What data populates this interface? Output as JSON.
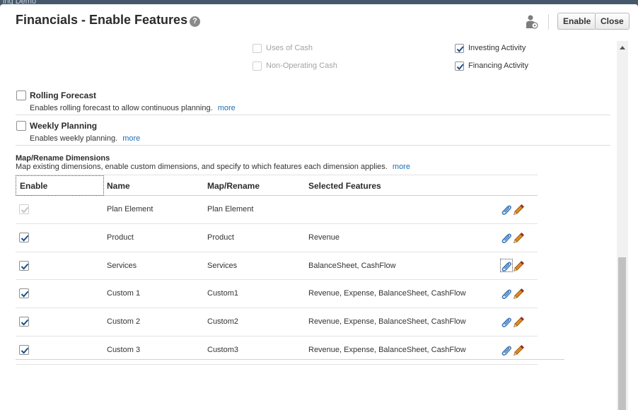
{
  "background": {
    "text": "ing Demo"
  },
  "dialog": {
    "title": "Financials - Enable Features",
    "help_icon": "?",
    "buttons": {
      "enable": "Enable",
      "close": "Close"
    }
  },
  "cash_options": [
    {
      "label": "Uses of Cash",
      "checked": false,
      "disabled": true
    },
    {
      "label": "Non-Operating Cash",
      "checked": false,
      "disabled": true
    },
    {
      "label": "Investing Activity",
      "checked": true,
      "disabled": false
    },
    {
      "label": "Financing Activity",
      "checked": true,
      "disabled": false
    }
  ],
  "features": {
    "rolling_forecast": {
      "name": "Rolling Forecast",
      "description": "Enables rolling forecast to allow continuous planning.",
      "more": "more",
      "checked": false
    },
    "weekly_planning": {
      "name": "Weekly Planning",
      "description": "Enables weekly planning.",
      "more": "more",
      "checked": false
    }
  },
  "map_rename": {
    "title": "Map/Rename Dimensions",
    "description": "Map existing dimensions, enable custom dimensions, and specify to which features each dimension applies.",
    "more": "more",
    "columns": [
      "Enable",
      "Name",
      "Map/Rename",
      "Selected Features"
    ],
    "rows": [
      {
        "enabled": true,
        "locked": true,
        "name": "Plan Element",
        "map": "Plan Element",
        "features": ""
      },
      {
        "enabled": true,
        "locked": false,
        "name": "Product",
        "map": "Product",
        "features": "Revenue"
      },
      {
        "enabled": true,
        "locked": false,
        "name": "Services",
        "map": "Services",
        "features": "BalanceSheet, CashFlow"
      },
      {
        "enabled": true,
        "locked": false,
        "name": "Custom 1",
        "map": "Custom1",
        "features": "Revenue, Expense, BalanceSheet, CashFlow"
      },
      {
        "enabled": true,
        "locked": false,
        "name": "Custom 2",
        "map": "Custom2",
        "features": "Revenue, Expense, BalanceSheet, CashFlow"
      },
      {
        "enabled": true,
        "locked": false,
        "name": "Custom 3",
        "map": "Custom3",
        "features": "Revenue, Expense, BalanceSheet, CashFlow"
      }
    ]
  },
  "colors": {
    "accent": "#1f6fb2",
    "check": "#1a4f8a"
  }
}
